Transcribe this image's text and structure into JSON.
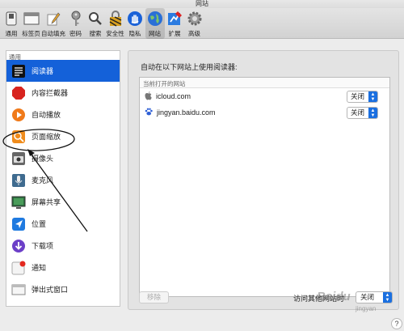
{
  "window": {
    "title": "网站"
  },
  "toolbar": {
    "items": [
      {
        "label": "通用",
        "icon": "switch-icon"
      },
      {
        "label": "标签页",
        "icon": "tabs-icon"
      },
      {
        "label": "自动填充",
        "icon": "pencil-icon"
      },
      {
        "label": "密码",
        "icon": "key-icon"
      },
      {
        "label": "搜索",
        "icon": "magnifier-icon"
      },
      {
        "label": "安全性",
        "icon": "lock-icon"
      },
      {
        "label": "隐私",
        "icon": "hand-icon"
      },
      {
        "label": "网站",
        "icon": "globe-icon",
        "active": true
      },
      {
        "label": "扩展",
        "icon": "puzzle-icon"
      },
      {
        "label": "高级",
        "icon": "gear-icon"
      }
    ]
  },
  "sidebar": {
    "section": "通用",
    "items": [
      {
        "label": "阅读器",
        "icon": "reader-icon",
        "selected": true
      },
      {
        "label": "内容拦截器",
        "icon": "stop-sign-icon"
      },
      {
        "label": "自动播放",
        "icon": "play-icon"
      },
      {
        "label": "页面缩放",
        "icon": "zoom-icon"
      },
      {
        "label": "摄像头",
        "icon": "camera-icon"
      },
      {
        "label": "麦克风",
        "icon": "microphone-icon"
      },
      {
        "label": "屏幕共享",
        "icon": "screen-share-icon"
      },
      {
        "label": "位置",
        "icon": "location-icon"
      },
      {
        "label": "下载项",
        "icon": "download-icon"
      },
      {
        "label": "通知",
        "icon": "notification-icon"
      },
      {
        "label": "弹出式窗口",
        "icon": "popup-window-icon"
      }
    ]
  },
  "main": {
    "title": "自动在以下网站上使用阅读器:",
    "list_header": "当前打开的网站",
    "sites": [
      {
        "name": "icloud.com",
        "icon": "apple-icon",
        "setting": "关闭"
      },
      {
        "name": "jingyan.baidu.com",
        "icon": "baidu-paw-icon",
        "setting": "关闭"
      }
    ],
    "remove_label": "移除",
    "other_sites_label": "访问其他网站时",
    "other_sites_value": "关闭"
  },
  "help": {
    "label": "?"
  },
  "watermark": {
    "text": "Baidu",
    "subtext": "jingyan"
  },
  "colors": {
    "selection": "#1461d9",
    "popup_arrow": "#1a6fe0",
    "annotation": "#111111"
  }
}
